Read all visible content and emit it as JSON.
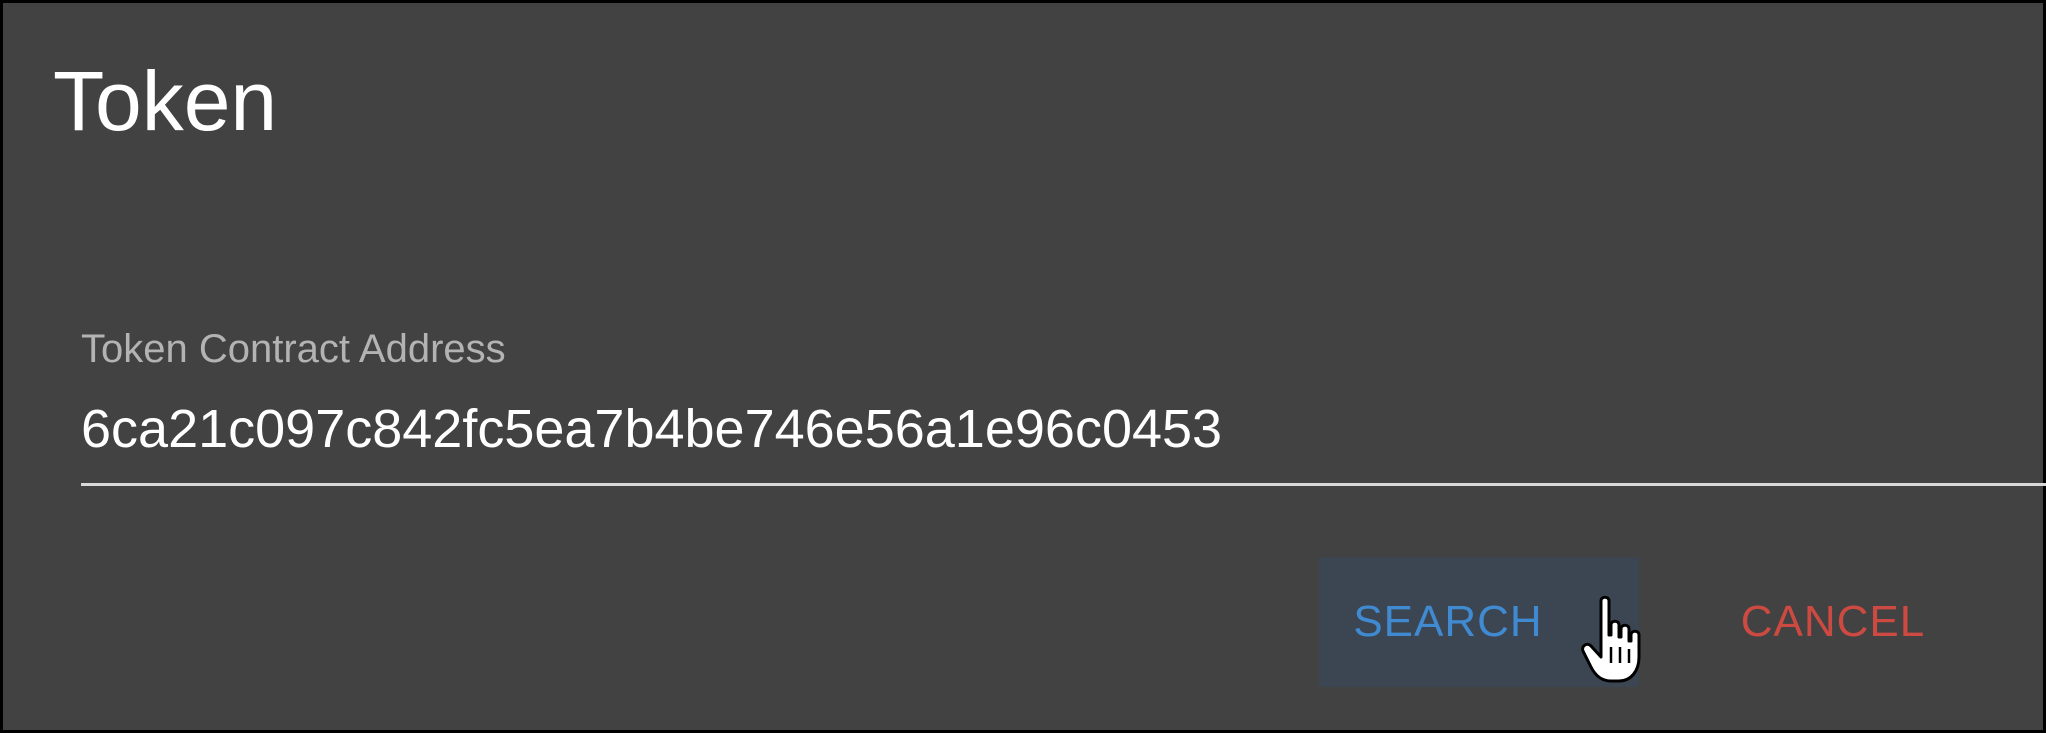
{
  "dialog": {
    "title": "Token",
    "field": {
      "label": "Token Contract Address",
      "value": "6ca21c097c842fc5ea7b4be746e56a1e96c0453"
    },
    "actions": {
      "search_label": "SEARCH",
      "cancel_label": "CANCEL"
    }
  },
  "colors": {
    "dialog_background": "#424242",
    "search_text": "#3f8ad1",
    "search_hover_background": "#3c4652",
    "cancel_text": "#cc4a41",
    "underline": "#d9d9d9"
  },
  "icons": {
    "cursor": "hand-pointer-cursor-icon"
  }
}
